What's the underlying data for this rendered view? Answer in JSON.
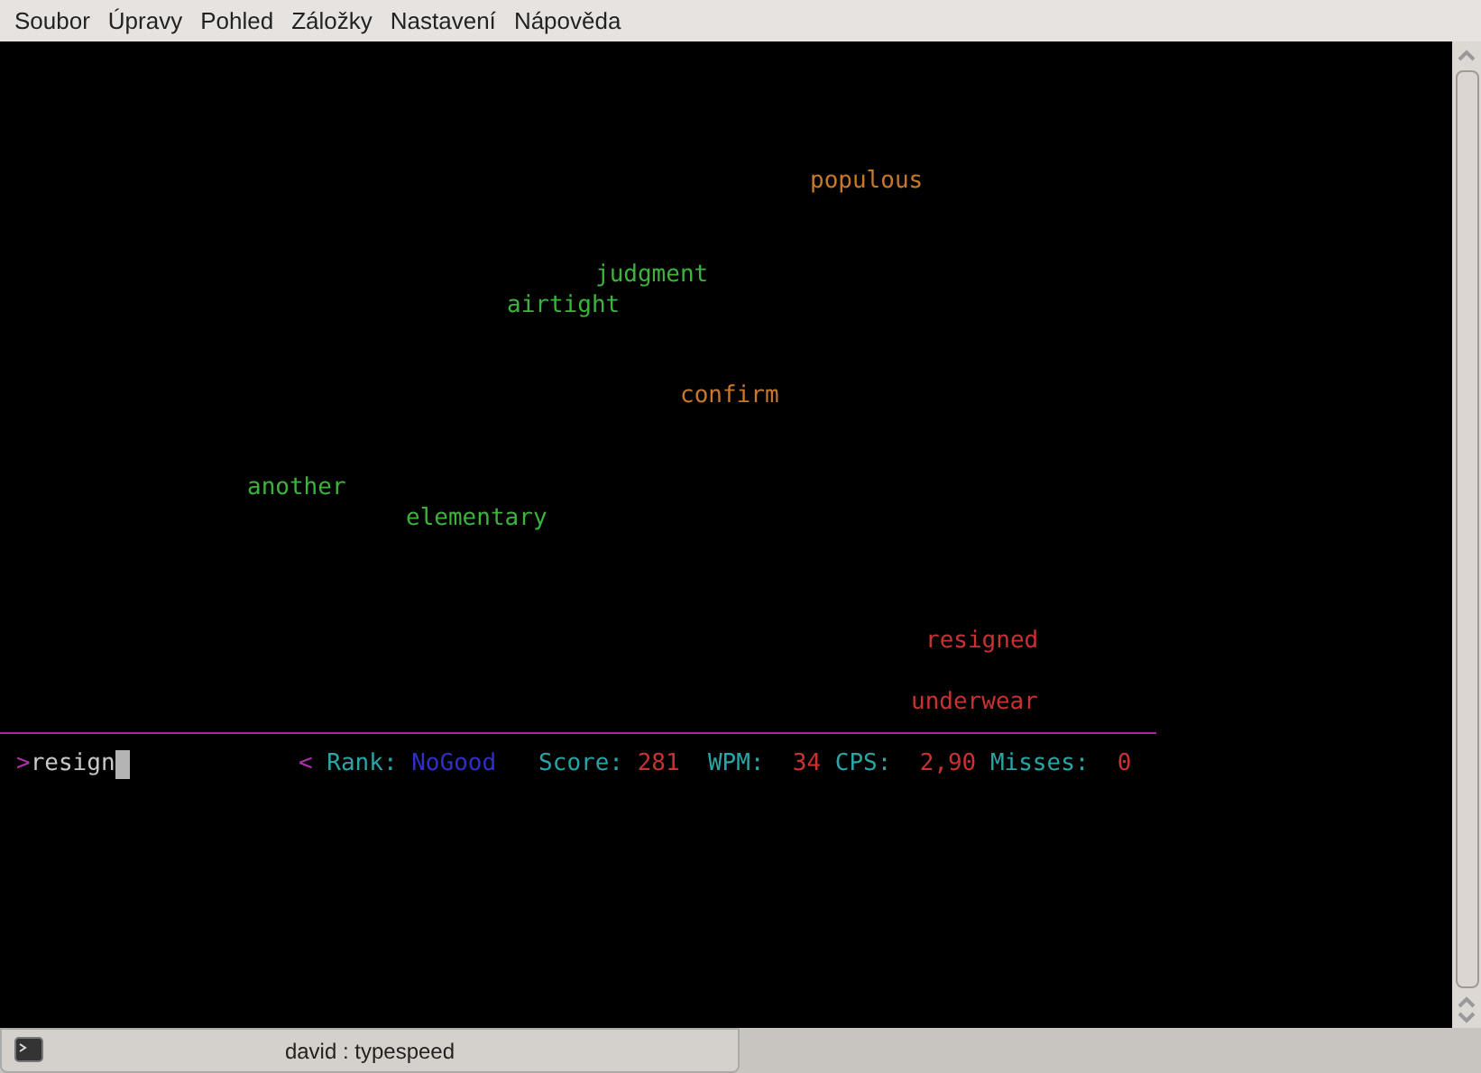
{
  "menu_bar": [
    "Soubor",
    "Úpravy",
    "Pohled",
    "Záložky",
    "Nastavení",
    "Nápověda"
  ],
  "words": [
    {
      "text": "populous",
      "color": "#c8782a"
    },
    {
      "text": "judgment",
      "color": "#3cb43c"
    },
    {
      "text": "airtight",
      "color": "#3cb43c"
    },
    {
      "text": "confirm",
      "color": "#c8782a"
    },
    {
      "text": "another",
      "color": "#3cb43c"
    },
    {
      "text": "elementary",
      "color": "#3cb43c"
    },
    {
      "text": "resigned",
      "color": "#c83232"
    },
    {
      "text": "underwear",
      "color": "#c83232"
    }
  ],
  "input": {
    "prompt": ">",
    "value": "resign"
  },
  "stats": [
    {
      "kind": "marker",
      "text": "<"
    },
    {
      "kind": "label",
      "text": "Rank:"
    },
    {
      "kind": "rank",
      "text": "NoGood"
    },
    {
      "kind": "label",
      "text": "Score:"
    },
    {
      "kind": "value",
      "text": "281"
    },
    {
      "kind": "label",
      "text": "WPM:"
    },
    {
      "kind": "value",
      "text": "34"
    },
    {
      "kind": "label",
      "text": "CPS:"
    },
    {
      "kind": "value",
      "text": "2,90"
    },
    {
      "kind": "label",
      "text": "Misses:"
    },
    {
      "kind": "value",
      "text": "0"
    }
  ],
  "taskbar": {
    "task": "david : typespeed"
  }
}
